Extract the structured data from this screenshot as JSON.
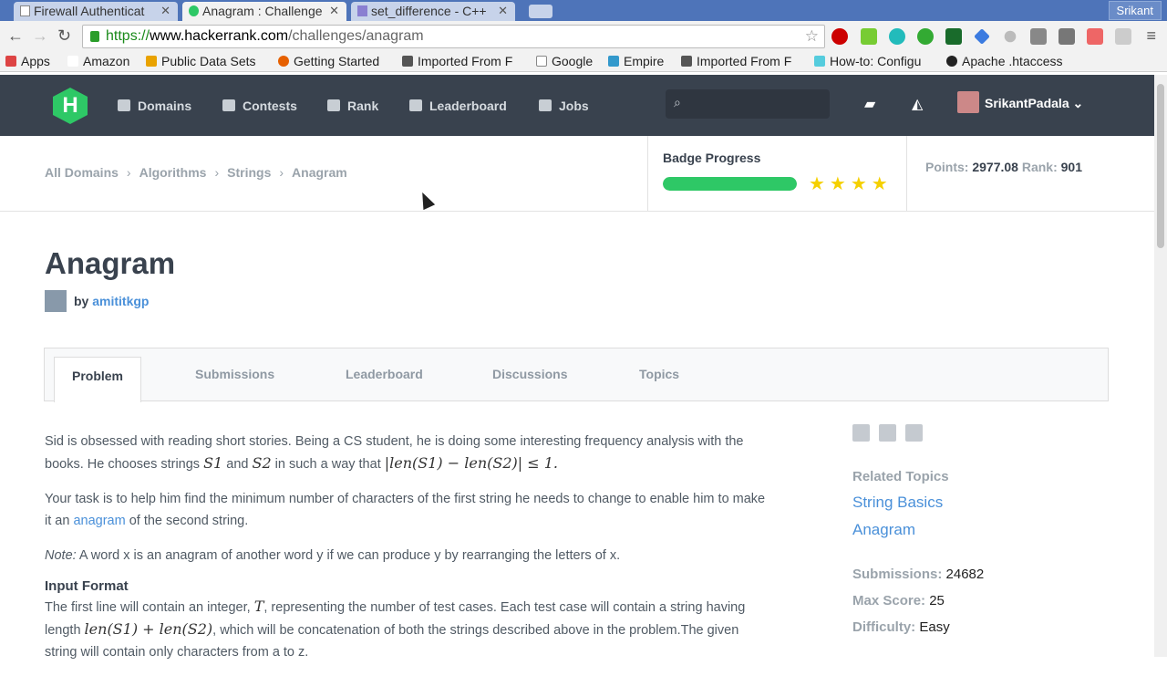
{
  "browser": {
    "tabs": [
      {
        "title": "Firewall Authenticat"
      },
      {
        "title": "Anagram : Challenge"
      },
      {
        "title": "set_difference - C++"
      }
    ],
    "user": "Srikant",
    "url": {
      "scheme": "https://",
      "domain": "www.hackerrank.com",
      "path": "/challenges/anagram"
    },
    "bookmarks": [
      "Apps",
      "Amazon",
      "Public Data Sets",
      "Getting Started",
      "Imported From F",
      "Google",
      "Empire",
      "Imported From F",
      "How-to: Configu",
      "Apache .htaccess"
    ]
  },
  "nav": {
    "logo": "H",
    "items": [
      "Domains",
      "Contests",
      "Rank",
      "Leaderboard",
      "Jobs"
    ],
    "username": "SrikantPadala"
  },
  "breadcrumb": [
    "All Domains",
    "Algorithms",
    "Strings",
    "Anagram"
  ],
  "badge": {
    "title": "Badge Progress",
    "progress_percent": 100,
    "stars": "★★★★"
  },
  "stats_header": {
    "points_label": "Points:",
    "points": "2977.08",
    "rank_label": "Rank:",
    "rank": "901"
  },
  "challenge": {
    "title": "Anagram",
    "by": "by",
    "author": "amititkgp"
  },
  "tabs": [
    "Problem",
    "Submissions",
    "Leaderboard",
    "Discussions",
    "Topics"
  ],
  "problem": {
    "p1a": "Sid is obsessed with reading short stories. Being a CS student, he is doing some interesting frequency analysis with the books. He chooses strings ",
    "s1": "S1",
    "and": " and ",
    "s2": "S2",
    "p1b": " in such a way that ",
    "math1": "|len(S1) − len(S2)| ≤ 1.",
    "p2a": "Your task is to help him find the minimum number of characters of the first string he needs to change to enable him to make it an ",
    "link": "anagram",
    "p2b": " of the second string.",
    "note": "Note:",
    "p3": " A word x is an anagram of another word y if we can produce y by rearranging the letters of x.",
    "input_heading": "Input Format",
    "p4a": "The first line will contain an integer, ",
    "T": "T",
    "p4b": ", representing the number of test cases. Each test case will contain a string having length ",
    "math2": "len(S1) + len(S2)",
    "p4c": ", which will be concatenation of both the strings described above in the problem.The given string will contain only characters from a to z."
  },
  "sidebar": {
    "related_label": "Related Topics",
    "topics": [
      "String Basics",
      "Anagram"
    ],
    "submissions_label": "Submissions:",
    "submissions": "24682",
    "max_score_label": "Max Score:",
    "max_score": "25",
    "difficulty_label": "Difficulty:",
    "difficulty": "Easy"
  }
}
